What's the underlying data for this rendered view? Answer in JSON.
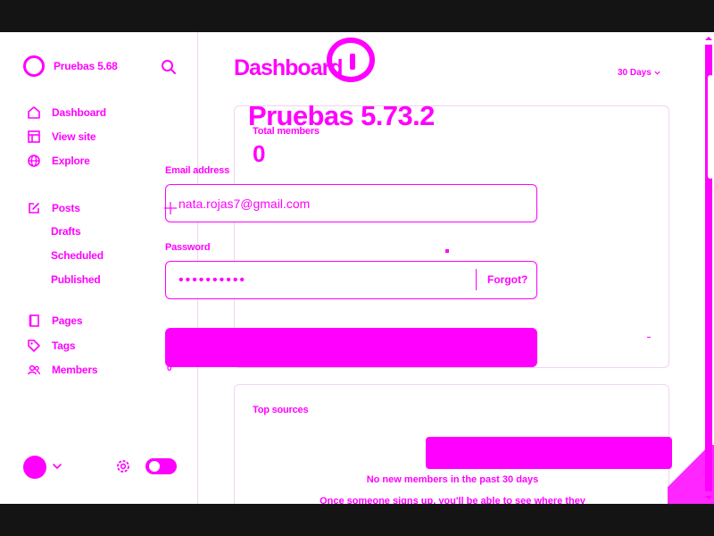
{
  "app": {
    "brand": "Pruebas 5.68"
  },
  "sidebar": {
    "items": [
      {
        "label": "Dashboard",
        "icon": "home-icon"
      },
      {
        "label": "View site",
        "icon": "layout-icon"
      },
      {
        "label": "Explore",
        "icon": "globe-icon"
      },
      {
        "label": "Posts",
        "icon": "edit-icon"
      },
      {
        "label": "Drafts"
      },
      {
        "label": "Scheduled"
      },
      {
        "label": "Published"
      },
      {
        "label": "Pages",
        "icon": "pages-icon"
      },
      {
        "label": "Tags",
        "icon": "tag-icon"
      },
      {
        "label": "Members",
        "icon": "members-icon"
      }
    ]
  },
  "header": {
    "title": "Dashboard",
    "range": "30 Days"
  },
  "cards": {
    "members": {
      "label": "Total members",
      "count": "0"
    },
    "sources": {
      "label": "Top sources",
      "empty_title": "No new members in the past 30 days",
      "empty_desc": "Once someone signs up, you'll be able to see where they"
    }
  },
  "login": {
    "title": "Pruebas 5.73.2",
    "email_label": "Email address",
    "email_value": "nata.rojas7@gmail.com",
    "password_label": "Password",
    "password_value": "••••••••••",
    "forgot_label": "Forgot?",
    "submit_label": "",
    "stray_zero": "0"
  },
  "colors": {
    "accent": "#ff00ff",
    "background": "#ffffff",
    "letterbox": "#141414"
  }
}
